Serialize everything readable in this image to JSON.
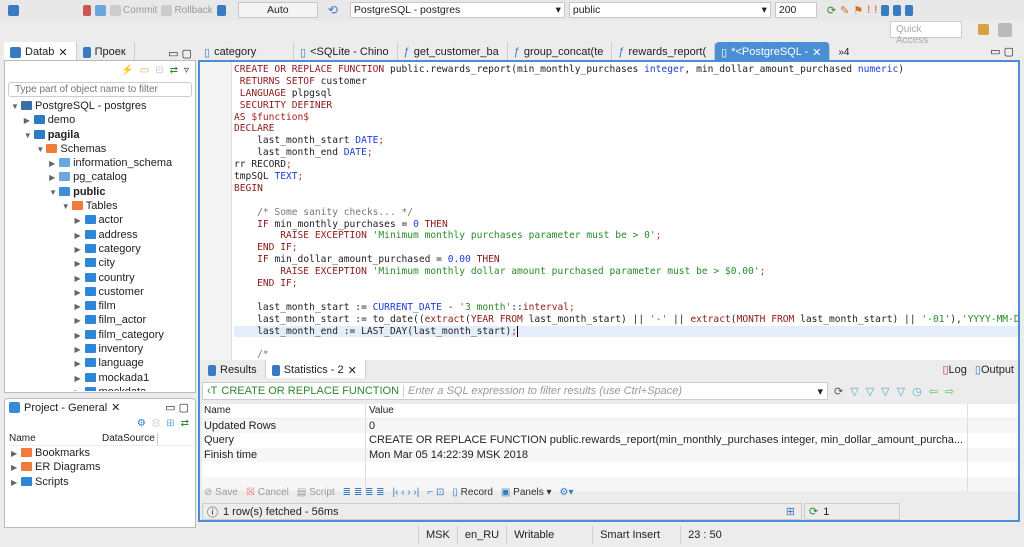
{
  "toolbar": {
    "commit": "Commit",
    "rollback": "Rollback",
    "tx_mode": "Auto",
    "datasource": "PostgreSQL - postgres",
    "schema": "public",
    "limit": "200",
    "quick_access": "Quick Access"
  },
  "left_tabs": [
    {
      "label": "Datab"
    },
    {
      "label": "Проек"
    }
  ],
  "editor_tabs": [
    {
      "label": "category"
    },
    {
      "label": "<SQLite - Chino"
    },
    {
      "label": "get_customer_ba"
    },
    {
      "label": "group_concat(te"
    },
    {
      "label": "rewards_report("
    },
    {
      "label": "*<PostgreSQL -",
      "active": true
    }
  ],
  "more_tabs": "»4",
  "navigator": {
    "filter_placeholder": "Type part of object name to filter",
    "tree": [
      {
        "label": "PostgreSQL - postgres",
        "level": 0,
        "open": true,
        "icon": "connection-icon",
        "color": "#3a6ea5"
      },
      {
        "label": "demo",
        "level": 1,
        "open": false,
        "icon": "database-icon",
        "color": "#2e7bc4"
      },
      {
        "label": "pagila",
        "level": 1,
        "open": true,
        "bold": true,
        "icon": "database-icon",
        "color": "#2e7bc4"
      },
      {
        "label": "Schemas",
        "level": 2,
        "open": true,
        "icon": "folder-icon",
        "color": "#f07b3a"
      },
      {
        "label": "information_schema",
        "level": 3,
        "open": false,
        "icon": "schema-icon",
        "color": "#6aa6e0"
      },
      {
        "label": "pg_catalog",
        "level": 3,
        "open": false,
        "icon": "schema-icon",
        "color": "#6aa6e0"
      },
      {
        "label": "public",
        "level": 3,
        "open": true,
        "bold": true,
        "icon": "schema-icon",
        "color": "#3f8fd8"
      },
      {
        "label": "Tables",
        "level": 4,
        "open": true,
        "icon": "folder-icon",
        "color": "#f07b3a"
      },
      {
        "label": "actor",
        "level": 5,
        "icon": "table-icon",
        "color": "#2e86d6"
      },
      {
        "label": "address",
        "level": 5,
        "icon": "table-icon",
        "color": "#2e86d6"
      },
      {
        "label": "category",
        "level": 5,
        "icon": "table-icon",
        "color": "#2e86d6"
      },
      {
        "label": "city",
        "level": 5,
        "icon": "table-icon",
        "color": "#2e86d6"
      },
      {
        "label": "country",
        "level": 5,
        "icon": "table-icon",
        "color": "#2e86d6"
      },
      {
        "label": "customer",
        "level": 5,
        "icon": "table-icon",
        "color": "#2e86d6"
      },
      {
        "label": "film",
        "level": 5,
        "icon": "table-icon",
        "color": "#2e86d6"
      },
      {
        "label": "film_actor",
        "level": 5,
        "icon": "table-icon",
        "color": "#2e86d6"
      },
      {
        "label": "film_category",
        "level": 5,
        "icon": "table-icon",
        "color": "#2e86d6"
      },
      {
        "label": "inventory",
        "level": 5,
        "icon": "table-icon",
        "color": "#2e86d6"
      },
      {
        "label": "language",
        "level": 5,
        "icon": "table-icon",
        "color": "#2e86d6"
      },
      {
        "label": "mockada1",
        "level": 5,
        "icon": "table-icon",
        "color": "#2e86d6"
      },
      {
        "label": "mockdata",
        "level": 5,
        "icon": "table-icon",
        "color": "#2e86d6"
      }
    ]
  },
  "project": {
    "title": "Project - General",
    "col_name": "Name",
    "col_ds": "DataSource",
    "items": [
      {
        "label": "Bookmarks",
        "color": "#f07b3a"
      },
      {
        "label": "ER Diagrams",
        "color": "#f07b3a"
      },
      {
        "label": "Scripts",
        "color": "#2e86d6"
      }
    ]
  },
  "code": [
    [
      [
        "kw",
        "CREATE OR REPLACE FUNCTION "
      ],
      [
        "pl",
        "public.rewards_report(min_monthly_purchases "
      ],
      [
        "ty",
        "integer"
      ],
      [
        "pl",
        ", min_dollar_amount_purchased "
      ],
      [
        "ty",
        "numeric"
      ],
      [
        "pl",
        ")"
      ]
    ],
    [
      [
        "kw",
        " RETURNS SETOF "
      ],
      [
        "pl",
        "customer"
      ]
    ],
    [
      [
        "kw",
        " LANGUAGE "
      ],
      [
        "pl",
        "plpgsql"
      ]
    ],
    [
      [
        "kw",
        " SECURITY DEFINER"
      ]
    ],
    [
      [
        "kw",
        "AS "
      ],
      [
        "vr",
        "$function$"
      ]
    ],
    [
      [
        "kw",
        "DECLARE"
      ]
    ],
    [
      [
        "pl",
        "    last_month_start "
      ],
      [
        "ty",
        "DATE"
      ],
      [
        "pu",
        ";"
      ]
    ],
    [
      [
        "pl",
        "    last_month_end "
      ],
      [
        "ty",
        "DATE"
      ],
      [
        "pu",
        ";"
      ]
    ],
    [
      [
        "pl",
        "rr RECORD"
      ],
      [
        "pu",
        ";"
      ]
    ],
    [
      [
        "pl",
        "tmpSQL "
      ],
      [
        "ty",
        "TEXT"
      ],
      [
        "pu",
        ";"
      ]
    ],
    [
      [
        "kw",
        "BEGIN"
      ]
    ],
    [
      [
        "pl",
        ""
      ]
    ],
    [
      [
        "cm",
        "    /* Some sanity checks... */"
      ]
    ],
    [
      [
        "kw",
        "    IF "
      ],
      [
        "pl",
        "min_monthly_purchases = "
      ],
      [
        "nu",
        "0"
      ],
      [
        "kw",
        " THEN"
      ]
    ],
    [
      [
        "kw",
        "        RAISE EXCEPTION "
      ],
      [
        "st",
        "'Minimum monthly purchases parameter must be > 0'"
      ],
      [
        "pu",
        ";"
      ]
    ],
    [
      [
        "kw",
        "    END IF"
      ],
      [
        "pu",
        ";"
      ]
    ],
    [
      [
        "kw",
        "    IF "
      ],
      [
        "pl",
        "min_dollar_amount_purchased = "
      ],
      [
        "nu",
        "0.00"
      ],
      [
        "kw",
        " THEN"
      ]
    ],
    [
      [
        "kw",
        "        RAISE EXCEPTION "
      ],
      [
        "st",
        "'Minimum monthly dollar amount purchased parameter must be > $0.00'"
      ],
      [
        "pu",
        ";"
      ]
    ],
    [
      [
        "kw",
        "    END IF"
      ],
      [
        "pu",
        ";"
      ]
    ],
    [
      [
        "pl",
        ""
      ]
    ],
    [
      [
        "pl",
        "    last_month_start := "
      ],
      [
        "ty",
        "CURRENT_DATE"
      ],
      [
        "pl",
        " - "
      ],
      [
        "st",
        "'3 month'"
      ],
      [
        "pl",
        "::"
      ],
      [
        "kw",
        "interval"
      ],
      [
        "pu",
        ";"
      ]
    ],
    [
      [
        "pl",
        "    last_month_start := to_date(("
      ],
      [
        "kw",
        "extract"
      ],
      [
        "pl",
        "("
      ],
      [
        "kw",
        "YEAR FROM "
      ],
      [
        "pl",
        "last_month_start) || "
      ],
      [
        "st",
        "'-'"
      ],
      [
        "pl",
        " || "
      ],
      [
        "kw",
        "extract"
      ],
      [
        "pl",
        "("
      ],
      [
        "kw",
        "MONTH FROM "
      ],
      [
        "pl",
        "last_month_start) || "
      ],
      [
        "st",
        "'-01'"
      ],
      [
        "pl",
        "),"
      ],
      [
        "st",
        "'YYYY-MM-DD'"
      ],
      [
        "pl",
        ")"
      ],
      [
        "pu",
        ";"
      ]
    ],
    [
      [
        "pl",
        "    last_month_end := LAST_DAY(last_month_start)"
      ],
      [
        "pu",
        ";"
      ]
    ],
    [
      [
        "pl",
        ""
      ]
    ],
    [
      [
        "cm",
        "    /*"
      ]
    ]
  ],
  "results": {
    "tabs": [
      {
        "label": "Results"
      },
      {
        "label": "Statistics - 2"
      }
    ],
    "log": "Log",
    "output": "Output",
    "filter_query": "CREATE OR REPLACE FUNCTION",
    "filter_placeholder": "Enter a SQL expression to filter results (use Ctrl+Space)",
    "columns": [
      "Name",
      "Value"
    ],
    "rows": [
      [
        "Updated Rows",
        "0"
      ],
      [
        "Query",
        "CREATE OR REPLACE FUNCTION public.rewards_report(min_monthly_purchases integer, min_dollar_amount_purcha..."
      ],
      [
        "Finish time",
        "Mon Mar 05 14:22:39 MSK 2018"
      ]
    ],
    "actions": {
      "save": "Save",
      "cancel": "Cancel",
      "script": "Script",
      "record": "Record",
      "panels": "Panels"
    },
    "fetched": "1 row(s) fetched - 56ms",
    "count": "1"
  },
  "statusbar": {
    "tz": "MSK",
    "locale": "en_RU",
    "mode": "Writable",
    "insert": "Smart Insert",
    "pos": "23 : 50"
  },
  "colors": {
    "accent": "#4a8fd3",
    "keyword": "#8b1a1a",
    "string": "#2a8a2a",
    "type": "#1a3ed6"
  }
}
